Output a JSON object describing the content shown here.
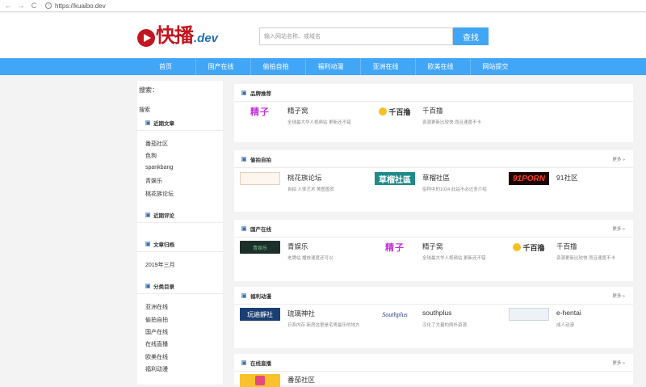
{
  "browser": {
    "back_glyph": "←",
    "forward_glyph": "→",
    "reload_glyph": "C",
    "url": "https://kuaibo.dev"
  },
  "header": {
    "logo_text": "快播",
    "logo_suffix": ".dev",
    "search_placeholder": "输入网站名称、或域名",
    "search_button": "查找"
  },
  "nav": [
    "首页",
    "国产在线",
    "偷拍自拍",
    "福利动漫",
    "亚洲在线",
    "欧美在线",
    "网站提交"
  ],
  "sidebar": {
    "search_label": "搜索：",
    "search_word": "搜索",
    "recent_posts_title": "近期文章",
    "recent_posts": [
      "番茄社区",
      "色狗",
      "spankbang",
      "青娱乐",
      "桃花族论坛"
    ],
    "recent_comments_title": "近期评论",
    "archives_title": "文章归档",
    "archives": [
      "2019年三月"
    ],
    "categories_title": "分类目录",
    "categories": [
      "亚洲在线",
      "偷拍自拍",
      "国产在线",
      "在线直播",
      "欧美在线",
      "福利动漫"
    ]
  },
  "sections": [
    {
      "title": "品牌推荐",
      "more": "",
      "sites": [
        {
          "thumb": "精子",
          "name": "精子窝",
          "desc": "全球最大华人视频站 更新还不错"
        },
        {
          "thumb": "千百撸",
          "name": "千百撸",
          "desc": "资源更新比较快 而且速度不卡"
        }
      ]
    },
    {
      "title": "偷拍自拍",
      "more": "更多 »",
      "sites": [
        {
          "thumb": "",
          "name": "桃花族论坛",
          "desc": "自拍 人体艺术 美图盈贺"
        },
        {
          "thumb": "草榴社區",
          "name": "草榴社區",
          "desc": "俗称中的1024 此站不必过多介绍"
        },
        {
          "thumb": "91PORN",
          "name": "91社区",
          "desc": ""
        }
      ]
    },
    {
      "title": "国产在线",
      "more": "更多 »",
      "sites": [
        {
          "thumb": "青娱乐",
          "name": "青娱乐",
          "desc": "老牌站 播放速度还可以"
        },
        {
          "thumb": "精子",
          "name": "精子窝",
          "desc": "全球最大华人视频站 更新还不错"
        },
        {
          "thumb": "千百撸",
          "name": "千百撸",
          "desc": "资源更新比较快 而且速度不卡"
        }
      ]
    },
    {
      "title": "福利动漫",
      "more": "更多 »",
      "sites": [
        {
          "thumb": "玩遍靜社",
          "name": "琉璃神社",
          "desc": "日系内存 新房这里是宅男最乐的地方"
        },
        {
          "thumb": "Southplus",
          "name": "southplus",
          "desc": "汉化了大量的两外资源"
        },
        {
          "thumb": "",
          "name": "e-hentai",
          "desc": "成人动漫"
        }
      ]
    },
    {
      "title": "在线直播",
      "more": "更多 »",
      "sites": [
        {
          "thumb": "",
          "name": "番茄社区",
          "desc": ""
        }
      ]
    }
  ]
}
